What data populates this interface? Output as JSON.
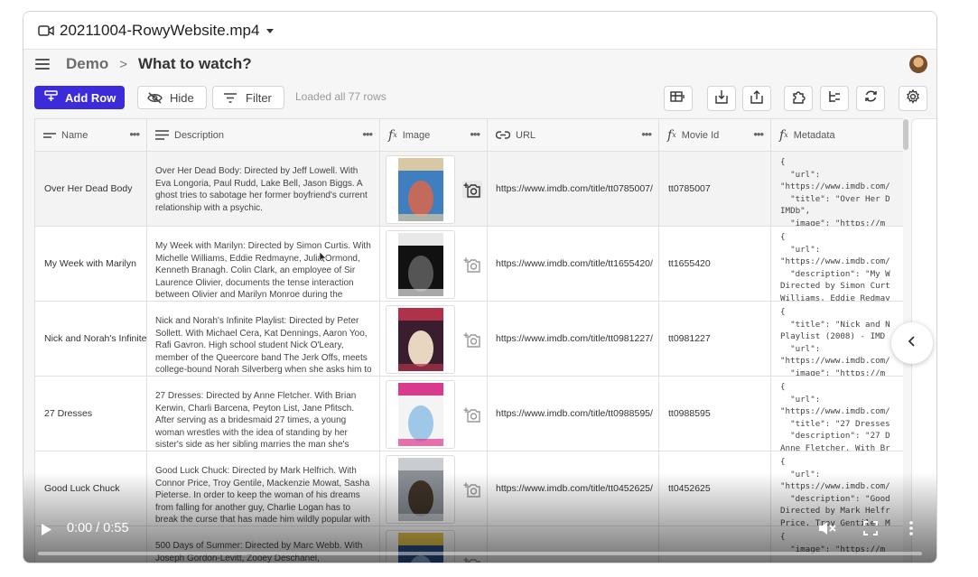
{
  "titlebar": {
    "filename": "20211004-RowyWebsite.mp4"
  },
  "app": {
    "breadcrumb": {
      "parent": "Demo",
      "separator": ">",
      "current": "What to watch?"
    }
  },
  "toolbar": {
    "add_row": "Add Row",
    "hide": "Hide",
    "filter": "Filter",
    "status": "Loaded all 77 rows"
  },
  "columns": [
    {
      "label": "Name",
      "icon": "short-text-icon"
    },
    {
      "label": "Description",
      "icon": "long-text-icon"
    },
    {
      "label": "Image",
      "icon": "fx-icon"
    },
    {
      "label": "URL",
      "icon": "link-icon"
    },
    {
      "label": "Movie Id",
      "icon": "fx-icon"
    },
    {
      "label": "Metadata",
      "icon": "fx-icon"
    }
  ],
  "column_menu": "•••",
  "rows": [
    {
      "name": "Over Her Dead Body",
      "description": "Over Her Dead Body: Directed by Jeff Lowell. With Eva Longoria, Paul Rudd, Lake Bell, Jason Biggs. A ghost tries to sabotage her former boyfriend's current relationship with a psychic.",
      "url": "https://www.imdb.com/title/tt0785007/",
      "movie_id": "tt0785007",
      "metadata": "{\n  \"url\":\n\"https://www.imdb.com/\n  \"title\": \"Over Her D\nIMDb\",\n  \"image\": \"https://m",
      "poster_colors": [
        "#3f7fc0",
        "#d8c9a4",
        "#c46a5c"
      ]
    },
    {
      "name": "My Week with Marilyn",
      "description": "My Week with Marilyn: Directed by Simon Curtis. With Michelle Williams, Eddie Redmayne, Julia Ormond, Kenneth Branagh. Colin Clark, an employee of Sir Laurence Olivier, documents the tense interaction between Olivier and Marilyn Monroe during the",
      "url": "https://www.imdb.com/title/tt1655420/",
      "movie_id": "tt1655420",
      "metadata": "{\n  \"url\":\n\"https://www.imdb.com/\n  \"description\": \"My W\nDirected by Simon Curt\nWilliams, Eddie Redmay",
      "poster_colors": [
        "#111111",
        "#e8e8e8",
        "#555555"
      ]
    },
    {
      "name": "Nick and Norah's Infinite Playlist",
      "description": "Nick and Norah's Infinite Playlist: Directed by Peter Sollett. With Michael Cera, Kat Dennings, Aaron Yoo, Rafi Gavron. High school student Nick O'Leary, member of the Queercore band The Jerk Offs, meets college-bound Norah Silverberg when she asks him to be her",
      "url": "https://www.imdb.com/title/tt0981227/",
      "movie_id": "tt0981227",
      "metadata": "{\n  \"title\": \"Nick and N\nPlaylist (2008) - IMD\n  \"url\":\n\"https://www.imdb.com/\n  \"image\": \"https://m",
      "poster_colors": [
        "#3a1d2e",
        "#b0324a",
        "#e8d6c0"
      ]
    },
    {
      "name": "27 Dresses",
      "description": "27 Dresses: Directed by Anne Fletcher. With Brian Kerwin, Charli Barcena, Peyton List, Jane Pfitsch. After serving as a bridesmaid 27 times, a young woman wrestles with the idea of standing by her sister's side as her sibling marries the man she's secretly in love with.",
      "url": "https://www.imdb.com/title/tt0988595/",
      "movie_id": "tt0988595",
      "metadata": "{\n  \"url\":\n\"https://www.imdb.com/\n  \"title\": \"27 Dresses\n  \"description\": \"27 D\nAnne Fletcher. With Br",
      "poster_colors": [
        "#f4f4f4",
        "#d83a8c",
        "#9ec7e8"
      ]
    },
    {
      "name": "Good Luck Chuck",
      "description": "Good Luck Chuck: Directed by Mark Helfrich. With Connor Price, Troy Gentile, Mackenzie Mowat, Sasha Pieterse. In order to keep the woman of his dreams from falling for another guy, Charlie Logan has to break the curse that has made him wildly popular with single",
      "url": "https://www.imdb.com/title/tt0452625/",
      "movie_id": "tt0452625",
      "metadata": "{\n  \"url\":\n\"https://www.imdb.com/\n  \"description\": \"Good\nDirected by Mark Helfr\nPrice, Troy Gentile, M",
      "poster_colors": [
        "#8a8f96",
        "#c9ccd0",
        "#3e3328"
      ]
    },
    {
      "name": "",
      "description": "500 Days of Summer: Directed by Marc Webb. With Joseph Gordon-Levitt, Zooey Deschanel,",
      "url": "",
      "movie_id": "",
      "metadata": "{\n  \"image\": \"https://m",
      "poster_colors": [
        "#2b4f8a",
        "#e0c24a",
        "#8ab0d8"
      ]
    }
  ],
  "player": {
    "time": "0:00 / 0:55",
    "progress": 0
  }
}
